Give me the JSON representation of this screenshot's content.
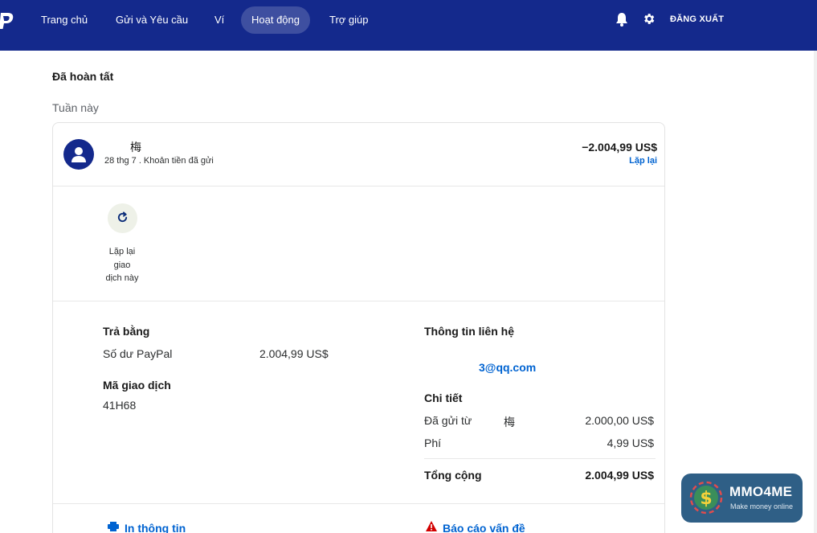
{
  "nav": {
    "items": [
      {
        "label": "Trang chủ",
        "active": false
      },
      {
        "label": "Gửi và Yêu cầu",
        "active": false
      },
      {
        "label": "Ví",
        "active": false
      },
      {
        "label": "Hoạt động",
        "active": true
      },
      {
        "label": "Trợ giúp",
        "active": false
      }
    ],
    "logout_label": "ĐĂNG XUẤT"
  },
  "page": {
    "status_title": "Đã hoàn tất",
    "period_label": "Tuần này"
  },
  "transaction": {
    "recipient_name": "梅",
    "meta": "28 thg 7 . Khoản tiền đã gửi",
    "amount": "−2.004,99 US$",
    "repeat_link": "Lặp lại"
  },
  "repeat_action": {
    "caption_lines": [
      "Lặp lại",
      "giao",
      "dịch này"
    ]
  },
  "payment": {
    "paid_with_label": "Trả bằng",
    "method": "Số dư PayPal",
    "method_amount": "2.004,99 US$",
    "tx_id_label": "Mã giao dịch",
    "tx_id": "41H68"
  },
  "contact": {
    "label": "Thông tin liên hệ",
    "email": "3@qq.com"
  },
  "details": {
    "label": "Chi tiết",
    "sent_from_label": "Đã gửi từ",
    "sent_from_name": "梅",
    "sent_amount": "2.000,00 US$",
    "fee_label": "Phí",
    "fee_amount": "4,99 US$",
    "total_label": "Tổng cộng",
    "total_amount": "2.004,99 US$"
  },
  "footer_links": {
    "print": "In thông tin",
    "report": "Báo cáo vấn đề"
  },
  "watermark": {
    "title": "MMO4ME",
    "subtitle": "Make money online"
  },
  "colors": {
    "nav_bg": "#14298c",
    "link": "#0063d1",
    "watermark_bg": "#2f5f86"
  }
}
